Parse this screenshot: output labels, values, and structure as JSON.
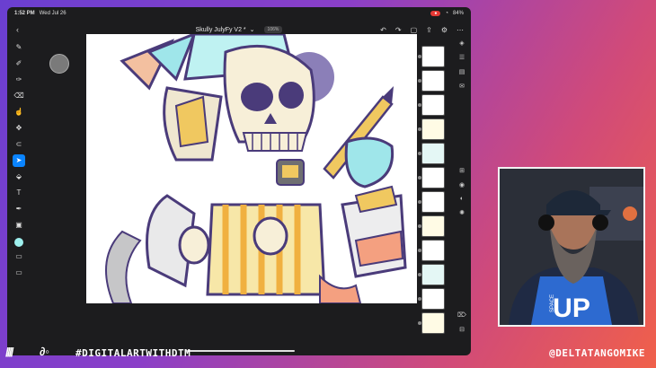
{
  "status": {
    "time": "1:52 PM",
    "date": "Wed Jul 26",
    "battery": "84%"
  },
  "app": {
    "title": "Skully JulyFy V2 *",
    "zoom": "106%"
  },
  "toolbar_left": [
    {
      "icon": "brush-icon",
      "glyph": "✎"
    },
    {
      "icon": "pencil-icon",
      "glyph": "✐"
    },
    {
      "icon": "ink-icon",
      "glyph": "✑"
    },
    {
      "icon": "eraser-icon",
      "glyph": "⌫"
    },
    {
      "icon": "smudge-icon",
      "glyph": "☝"
    },
    {
      "icon": "move-icon",
      "glyph": "✥"
    },
    {
      "icon": "lasso-icon",
      "glyph": "⊂"
    },
    {
      "icon": "select-icon",
      "glyph": "➤",
      "active": true
    },
    {
      "icon": "fill-icon",
      "glyph": "⬙"
    },
    {
      "icon": "text-icon",
      "glyph": "T"
    },
    {
      "icon": "eyedropper-icon",
      "glyph": "✒"
    },
    {
      "icon": "image-icon",
      "glyph": "▣"
    }
  ],
  "layers_count": 12,
  "overlay": {
    "hashtag": "#DIGITALARTWITHDTM",
    "handle": "@DELTATANGOMIKE",
    "shirt_text": "UP",
    "shirt_small": "SPACE"
  },
  "colors": {
    "active_tool": "#0a84ff",
    "current_color": "#9ef0ee",
    "record": "#e53935"
  }
}
